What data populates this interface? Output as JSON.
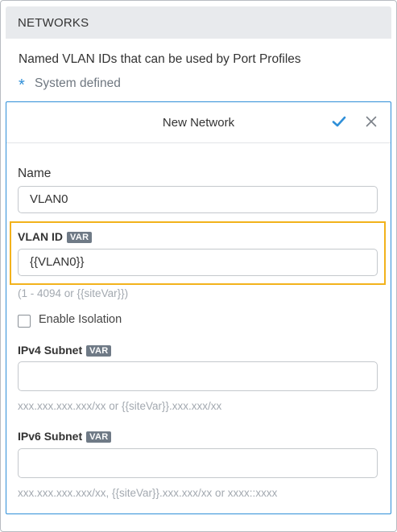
{
  "section": {
    "title": "NETWORKS",
    "description": "Named VLAN IDs that can be used by Port Profiles",
    "system_defined_marker": "*",
    "system_defined_label": "System defined"
  },
  "dialog": {
    "title": "New Network",
    "confirm_icon": "checkmark-icon",
    "close_icon": "close-icon",
    "accent_color": "#2f8fd8",
    "highlight_color": "#f2b21b",
    "fields": {
      "name": {
        "label": "Name",
        "value": "VLAN0"
      },
      "vlan_id": {
        "label": "VLAN ID",
        "badge": "VAR",
        "value": "{{VLAN0}}",
        "hint": "(1 - 4094 or {{siteVar}})"
      },
      "enable_isolation": {
        "label": "Enable Isolation",
        "checked": false
      },
      "ipv4_subnet": {
        "label": "IPv4 Subnet",
        "badge": "VAR",
        "value": "",
        "hint": "xxx.xxx.xxx.xxx/xx or {{siteVar}}.xxx.xxx/xx"
      },
      "ipv6_subnet": {
        "label": "IPv6 Subnet",
        "badge": "VAR",
        "value": "",
        "hint": "xxx.xxx.xxx.xxx/xx, {{siteVar}}.xxx.xxx/xx or xxxx::xxxx"
      }
    }
  }
}
